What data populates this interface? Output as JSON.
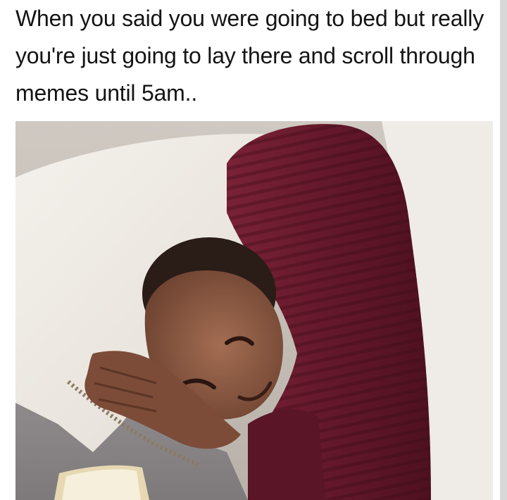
{
  "meme": {
    "caption": "When you said you were going to bed but really you're just going to lay there and scroll through memes until 5am.."
  },
  "photo": {
    "subject": "person-in-bed",
    "colors": {
      "robe": "#6b1c2e",
      "pillow": "#ece7e0",
      "sheet": "#8e8b8b",
      "skin": "#8a5a44"
    }
  }
}
